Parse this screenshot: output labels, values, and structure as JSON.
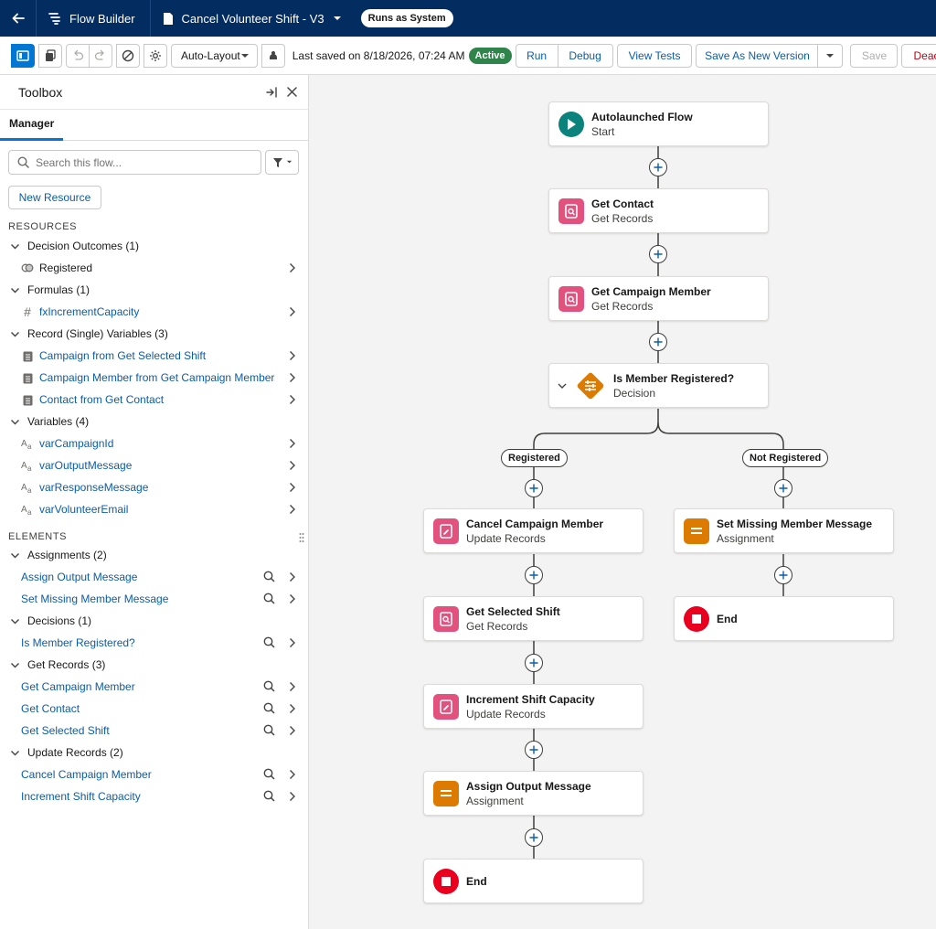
{
  "header": {
    "app_name": "Flow Builder",
    "flow_title": "Cancel Volunteer Shift - V3",
    "runs_as": "Runs as System"
  },
  "toolbar": {
    "layout_value": "Auto-Layout",
    "last_saved": "Last saved on 8/18/2026, 07:24 AM",
    "status": "Active",
    "run": "Run",
    "debug": "Debug",
    "view_tests": "View Tests",
    "save_as_new_version": "Save As New Version",
    "save": "Save",
    "deactivate": "Deact"
  },
  "toolbox": {
    "title": "Toolbox",
    "tab": "Manager",
    "search_placeholder": "Search this flow...",
    "new_resource": "New Resource",
    "resources_label": "RESOURCES",
    "elements_label": "ELEMENTS",
    "resources": [
      {
        "category": "Decision Outcomes (1)",
        "items": [
          {
            "label": "Registered",
            "icon": "outcome-icon"
          }
        ]
      },
      {
        "category": "Formulas (1)",
        "items": [
          {
            "label": "fxIncrementCapacity",
            "icon": "hash-icon"
          }
        ]
      },
      {
        "category": "Record (Single) Variables (3)",
        "items": [
          {
            "label": "Campaign from Get Selected Shift",
            "icon": "record-icon"
          },
          {
            "label": "Campaign Member from Get Campaign Member",
            "icon": "record-icon"
          },
          {
            "label": "Contact from Get Contact",
            "icon": "record-icon"
          }
        ]
      },
      {
        "category": "Variables (4)",
        "items": [
          {
            "label": "varCampaignId",
            "icon": "text-variable-icon"
          },
          {
            "label": "varOutputMessage",
            "icon": "text-variable-icon"
          },
          {
            "label": "varResponseMessage",
            "icon": "text-variable-icon"
          },
          {
            "label": "varVolunteerEmail",
            "icon": "text-variable-icon"
          }
        ]
      }
    ],
    "elements": [
      {
        "category": "Assignments (2)",
        "items": [
          "Assign Output Message",
          "Set Missing Member Message"
        ]
      },
      {
        "category": "Decisions (1)",
        "items": [
          "Is Member Registered?"
        ]
      },
      {
        "category": "Get Records (3)",
        "items": [
          "Get Campaign Member",
          "Get Contact",
          "Get Selected Shift"
        ]
      },
      {
        "category": "Update Records (2)",
        "items": [
          "Cancel Campaign Member",
          "Increment Shift Capacity"
        ]
      }
    ]
  },
  "canvas": {
    "nodes": {
      "start": {
        "title": "Autolaunched Flow",
        "subtitle": "Start"
      },
      "get_contact": {
        "title": "Get Contact",
        "subtitle": "Get Records"
      },
      "get_campaign_member": {
        "title": "Get Campaign Member",
        "subtitle": "Get Records"
      },
      "decision": {
        "title": "Is Member Registered?",
        "subtitle": "Decision"
      },
      "cancel_campaign_member": {
        "title": "Cancel Campaign Member",
        "subtitle": "Update Records"
      },
      "get_selected_shift": {
        "title": "Get Selected Shift",
        "subtitle": "Get Records"
      },
      "increment_shift_capacity": {
        "title": "Increment Shift Capacity",
        "subtitle": "Update Records"
      },
      "assign_output_message": {
        "title": "Assign Output Message",
        "subtitle": "Assignment"
      },
      "end_left": {
        "title": "End"
      },
      "set_missing_member_message": {
        "title": "Set Missing Member Message",
        "subtitle": "Assignment"
      },
      "end_right": {
        "title": "End"
      }
    },
    "branches": {
      "left": "Registered",
      "right": "Not Registered"
    }
  },
  "colors": {
    "header_bg": "#032d60",
    "brand_blue": "#0176d3",
    "active_green": "#2e844a",
    "start_teal": "#0b827c",
    "get_records_pink": "#e3527e",
    "decision_orange": "#dd7a01",
    "assignment_orange": "#dd7a01",
    "end_red": "#ea001e"
  }
}
